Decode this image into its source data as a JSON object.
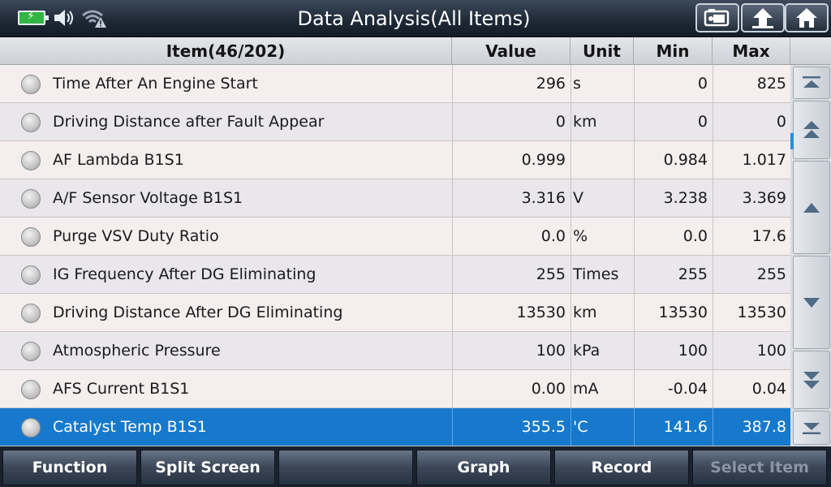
{
  "title": "Data Analysis(All Items)",
  "header": {
    "item": "Item(46/202)",
    "value": "Value",
    "unit": "Unit",
    "min": "Min",
    "max": "Max"
  },
  "rows": [
    {
      "name": "Time After An Engine Start",
      "value": "296",
      "unit": "s",
      "min": "0",
      "max": "825"
    },
    {
      "name": "Driving Distance after Fault Appear",
      "value": "0",
      "unit": "km",
      "min": "0",
      "max": "0"
    },
    {
      "name": "AF Lambda B1S1",
      "value": "0.999",
      "unit": "",
      "min": "0.984",
      "max": "1.017"
    },
    {
      "name": "A/F Sensor Voltage B1S1",
      "value": "3.316",
      "unit": "V",
      "min": "3.238",
      "max": "3.369"
    },
    {
      "name": "Purge VSV Duty Ratio",
      "value": "0.0",
      "unit": "%",
      "min": "0.0",
      "max": "17.6"
    },
    {
      "name": "IG Frequency After DG Eliminating",
      "value": "255",
      "unit": "Times",
      "min": "255",
      "max": "255"
    },
    {
      "name": "Driving Distance After DG Eliminating",
      "value": "13530",
      "unit": "km",
      "min": "13530",
      "max": "13530"
    },
    {
      "name": "Atmospheric Pressure",
      "value": "100",
      "unit": "kPa",
      "min": "100",
      "max": "100"
    },
    {
      "name": "AFS Current B1S1",
      "value": "0.00",
      "unit": "mA",
      "min": "-0.04",
      "max": "0.04"
    },
    {
      "name": "Catalyst Temp B1S1",
      "value": "355.5",
      "unit": "'C",
      "min": "141.6",
      "max": "387.8"
    }
  ],
  "selected_row": 9,
  "bottom": {
    "function": "Function",
    "split_screen": "Split Screen",
    "blank": "",
    "graph": "Graph",
    "record": "Record",
    "select_item": "Select Item"
  },
  "colors": {
    "selected_row": "#1779cc",
    "battery": "#31b543",
    "title_bar": "#1f2a38"
  },
  "icons": {
    "battery": "battery-charging-icon",
    "volume": "volume-icon",
    "wifi": "wifi-warning-icon",
    "screenshot": "screenshot-icon",
    "back": "back-arrow-icon",
    "home": "home-icon"
  }
}
